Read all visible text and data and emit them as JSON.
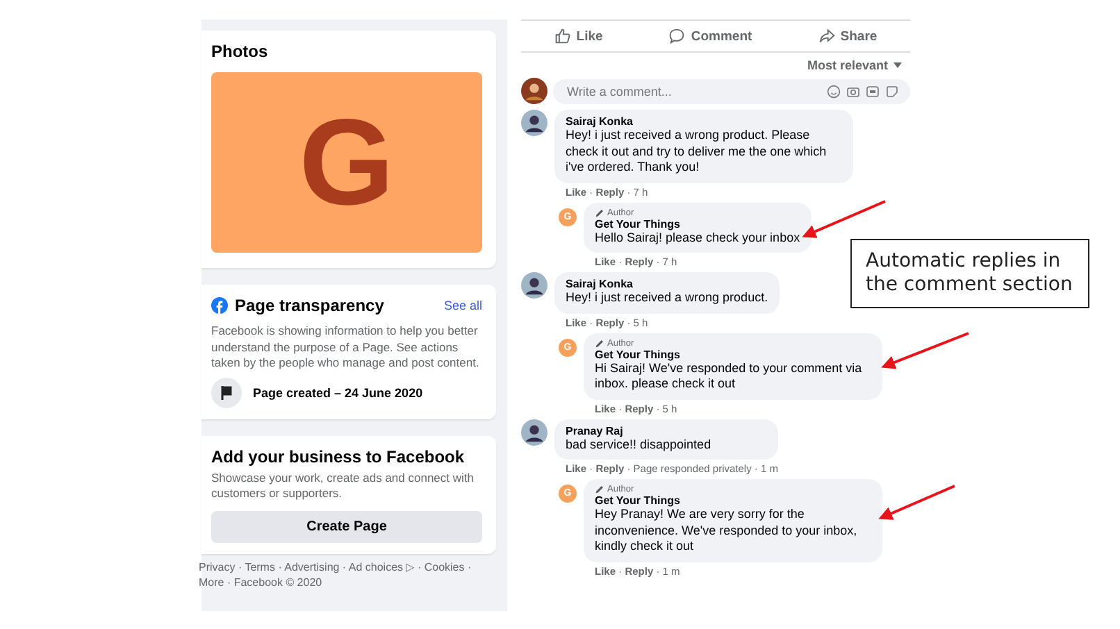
{
  "photos": {
    "title": "Photos",
    "letter": "G"
  },
  "transparency": {
    "title": "Page transparency",
    "link": "See all",
    "text": "Facebook is showing information to help you better understand the purpose of a Page. See actions taken by the people who manage and post content.",
    "created": "Page created – 24 June 2020"
  },
  "business": {
    "title": "Add your business to Facebook",
    "text": "Showcase your work, create ads and connect with customers or supporters.",
    "button": "Create Page"
  },
  "footer": [
    "Privacy · Terms · Advertising · Ad choices ▷ · Cookies ·",
    "More · Facebook © 2020"
  ],
  "actions": [
    {
      "label": "Like"
    },
    {
      "label": "Comment"
    },
    {
      "label": "Share"
    }
  ],
  "sort": "Most relevant",
  "composer": {
    "placeholder": "Write a comment..."
  },
  "comments": [
    {
      "kind": "comment",
      "author": "Sairaj Konka",
      "text": "Hey! i just received a wrong product. Please check it out and try to deliver me the one which i've ordered. Thank you!",
      "meta": "**Like** · **Reply** · 7 h"
    },
    {
      "kind": "reply",
      "badge": "Author",
      "avatar": "G",
      "author": "Get Your Things",
      "text": "Hello Sairaj! please check your inbox",
      "meta": "**Like** · **Reply** · 7 h"
    },
    {
      "kind": "comment",
      "author": "Sairaj Konka",
      "text": "Hey! i just received a wrong product.",
      "meta": "**Like** · **Reply** · 5 h"
    },
    {
      "kind": "reply",
      "badge": "Author",
      "avatar": "G",
      "author": "Get Your Things",
      "text": "Hi Sairaj! We've responded to your comment via inbox. please check it out",
      "meta": "**Like** · **Reply** · 5 h"
    },
    {
      "kind": "comment",
      "author": "Pranay Raj",
      "text": "bad service!! disappointed",
      "meta": "**Like** · **Reply** · Page responded privately · 1 m"
    },
    {
      "kind": "reply",
      "badge": "Author",
      "avatar": "G",
      "author": "Get Your Things",
      "text": "Hey Pranay! We are very sorry for the inconvenience. We've responded to your inbox, kindly check it out",
      "meta": "**Like** · **Reply** · 1 m"
    }
  ],
  "callout": "Automatic replies in the comment section"
}
